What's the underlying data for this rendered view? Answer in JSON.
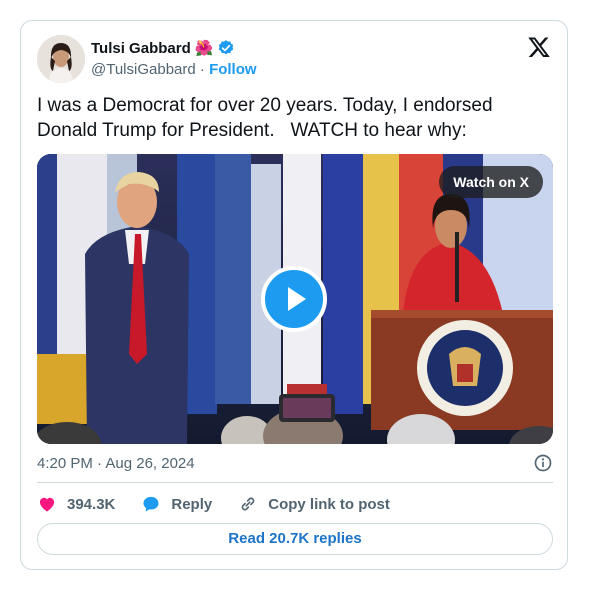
{
  "author": {
    "name": "Tulsi Gabbard",
    "emoji": "🌺",
    "handle": "@TulsiGabbard",
    "separator": "·",
    "follow_label": "Follow",
    "verified_color": "#1d9bf0"
  },
  "tweet": {
    "text": "I was a Democrat for over 20 years. Today, I endorsed\nDonald Trump for President.   WATCH to hear why:"
  },
  "media": {
    "watch_label": "Watch on X",
    "play_icon": "play-icon"
  },
  "meta": {
    "timestamp": "4:20 PM · Aug 26, 2024",
    "info_icon": "info-icon"
  },
  "actions": {
    "likes": "394.3K",
    "reply_label": "Reply",
    "copy_label": "Copy link to post"
  },
  "footer": {
    "read_replies_label": "Read 20.7K replies"
  },
  "colors": {
    "accent": "#1d9bf0",
    "like": "#f91880",
    "text": "#0f1419",
    "muted": "#536471",
    "border": "#cfd9de"
  }
}
